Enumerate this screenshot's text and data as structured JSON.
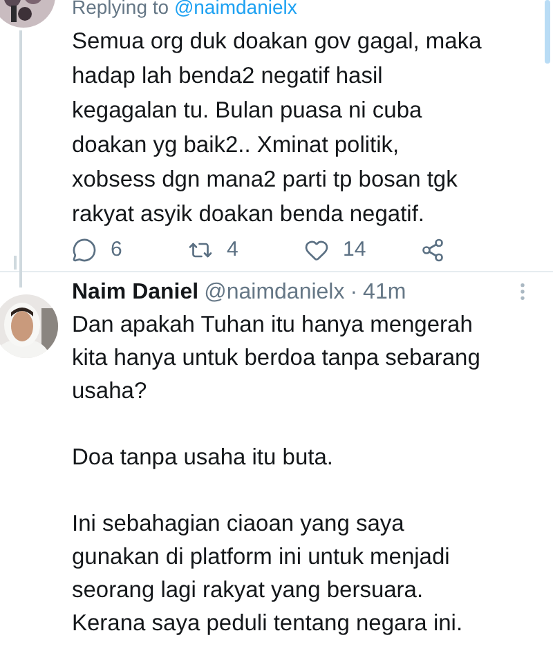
{
  "reply_tweet": {
    "replying_to_label": "Replying to",
    "replying_to_handle": "@naimdanielx",
    "lines": [
      "Semua org duk doakan gov gagal, maka",
      "hadap lah benda2 negatif hasil",
      "kegagalan tu. Bulan puasa ni cuba",
      "doakan yg baik2.. Xminat politik,",
      "xobsess dgn mana2 parti tp bosan tgk",
      "rakyat asyik doakan benda negatif."
    ],
    "actions": [
      {
        "kind": "reply",
        "count": "6"
      },
      {
        "kind": "retweet",
        "count": "4"
      },
      {
        "kind": "like",
        "count": "14"
      },
      {
        "kind": "share"
      }
    ]
  },
  "tweet": {
    "name": "Naim Daniel",
    "handle": "@naimdanielx",
    "separator": "·",
    "time": "41m",
    "paragraphs": [
      [
        "Dan apakah Tuhan itu hanya mengerah",
        "kita hanya untuk berdoa tanpa sebarang",
        "usaha?"
      ],
      [
        "Doa tanpa usaha itu buta."
      ],
      [
        "Ini sebahagian ciaoan yang saya",
        "gunakan di platform ini untuk menjadi",
        "seorang lagi rakyat yang bersuara.",
        "Kerana saya peduli tentang negara ini."
      ]
    ]
  }
}
